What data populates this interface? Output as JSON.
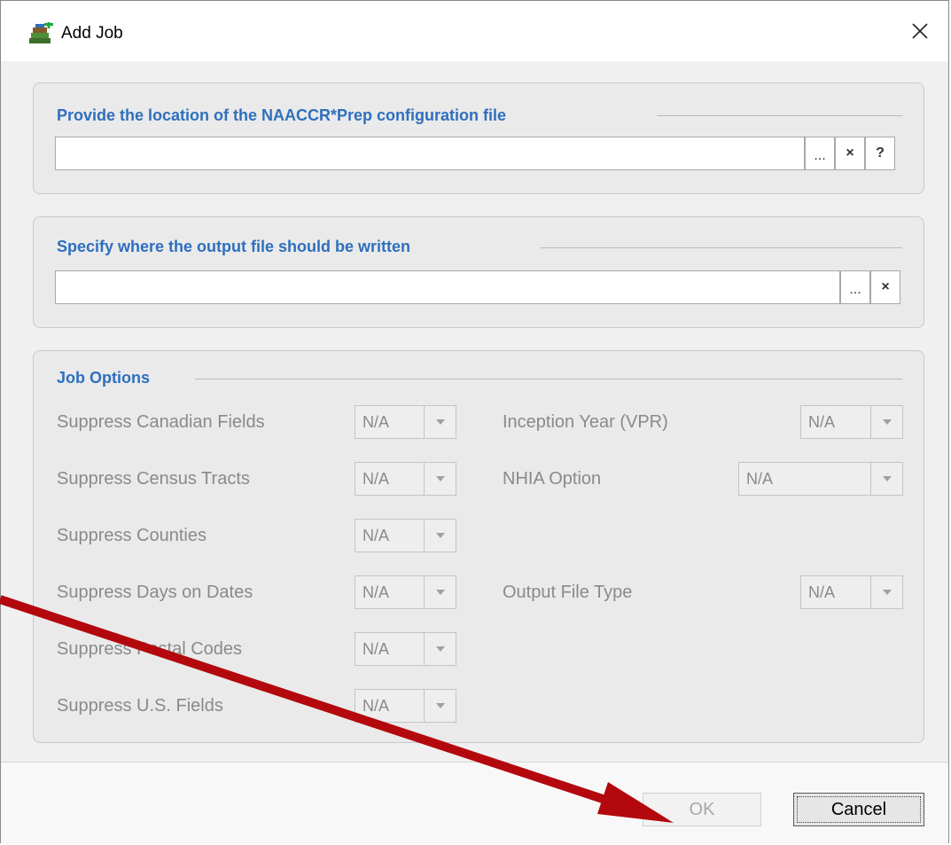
{
  "dialog": {
    "title": "Add Job",
    "close_glyph": "✕"
  },
  "config_group": {
    "title": "Provide the location of the NAACCR*Prep configuration file",
    "input_value": "",
    "browse_label": "...",
    "clear_label": "×",
    "help_label": "?"
  },
  "output_group": {
    "title": "Specify where the output file should be written",
    "input_value": "",
    "browse_label": "...",
    "clear_label": "×"
  },
  "job_options": {
    "title": "Job Options",
    "left": [
      {
        "label": "Suppress Canadian Fields",
        "value": "N/A"
      },
      {
        "label": "Suppress Census Tracts",
        "value": "N/A"
      },
      {
        "label": "Suppress Counties",
        "value": "N/A"
      },
      {
        "label": "Suppress Days on Dates",
        "value": "N/A"
      },
      {
        "label": "Suppress Postal Codes",
        "value": "N/A"
      },
      {
        "label": "Suppress U.S. Fields",
        "value": "N/A"
      }
    ],
    "right": [
      {
        "label": "Inception Year (VPR)",
        "value": "N/A"
      },
      {
        "label": "NHIA Option",
        "value": "N/A"
      },
      {
        "label": "Output File Type",
        "value": "N/A"
      }
    ]
  },
  "footer": {
    "ok_label": "OK",
    "cancel_label": "Cancel"
  },
  "colors": {
    "group_title": "#2e6fbe",
    "arrow": "#b3080d",
    "disabled_text": "#8a8a8a"
  },
  "icons": {
    "app": "add-job-icon",
    "close": "close-icon",
    "dropdown": "chevron-down-icon"
  }
}
